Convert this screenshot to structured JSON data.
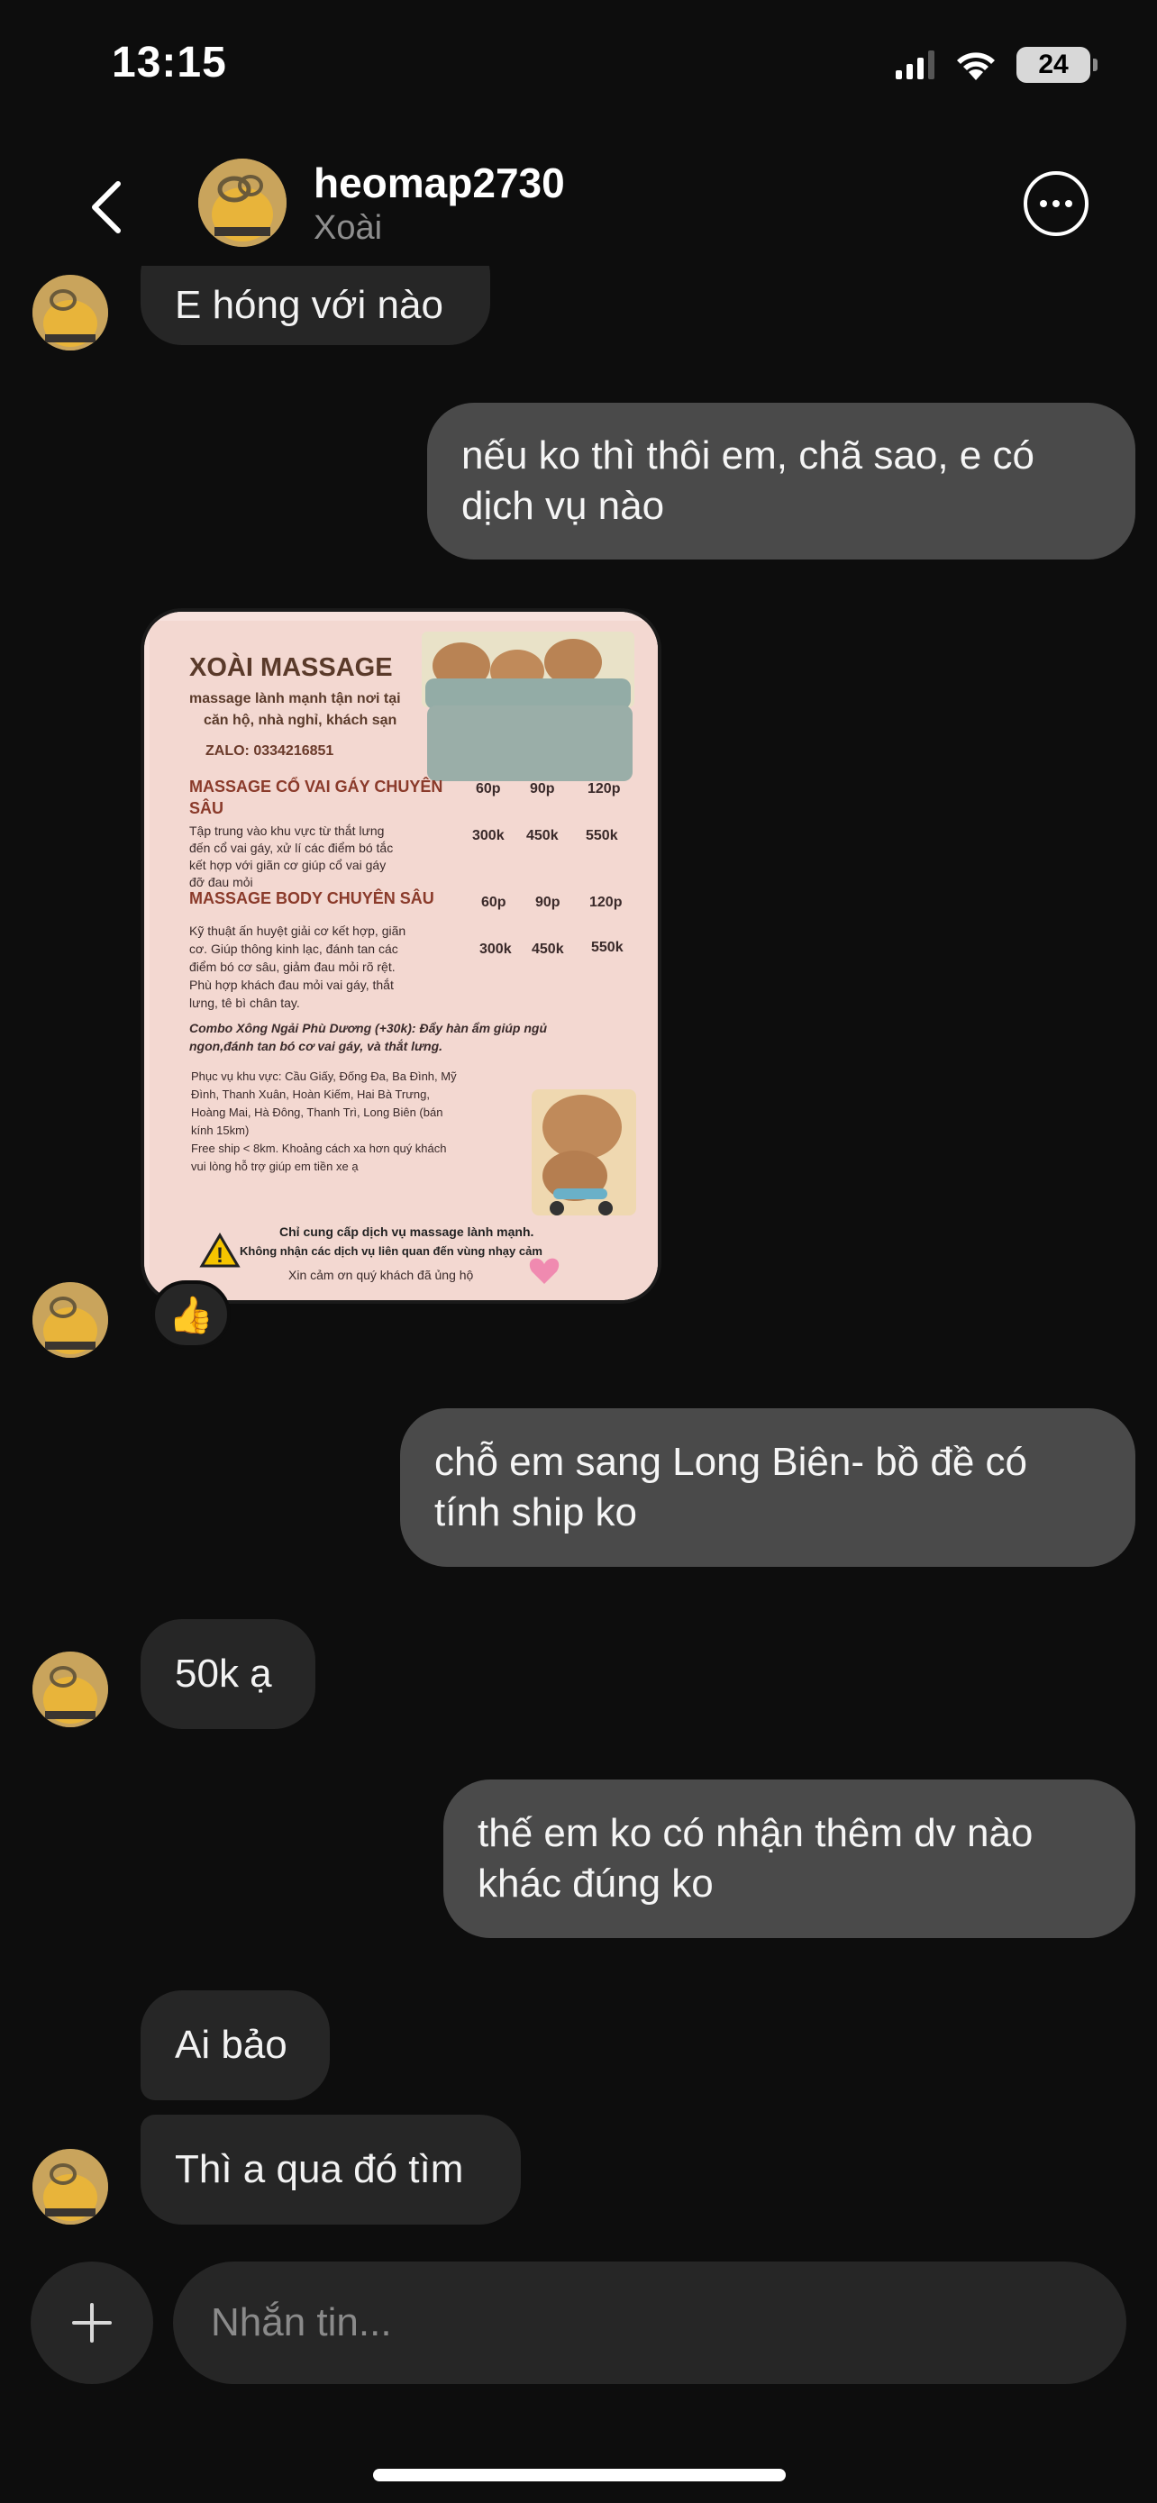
{
  "status_bar": {
    "time": "13:15",
    "battery": "24",
    "icons": [
      "signal-icon",
      "wifi-icon",
      "battery-icon"
    ]
  },
  "header": {
    "name": "heomap2730",
    "subtitle": "Xoài",
    "icons": [
      "back-arrow-icon",
      "more-options-icon"
    ]
  },
  "messages": [
    {
      "id": "m1",
      "direction": "in",
      "text": "E hóng với nào"
    },
    {
      "id": "m2",
      "direction": "out",
      "text": "nếu ko thì thôi em, chã sao, e có dịch vụ nào"
    },
    {
      "id": "m3",
      "direction": "in",
      "type": "image",
      "reaction": "👍"
    },
    {
      "id": "m4",
      "direction": "out",
      "text": "chỗ em sang Long Biên- bồ đề có tính ship ko"
    },
    {
      "id": "m5",
      "direction": "in",
      "text": "50k ạ"
    },
    {
      "id": "m6",
      "direction": "out",
      "text": "thế em ko có nhận thêm dv nào khác đúng ko"
    },
    {
      "id": "m7",
      "direction": "in",
      "text": "Ai bảo"
    },
    {
      "id": "m8",
      "direction": "in",
      "text": "Thì a qua đó tìm"
    }
  ],
  "flyer": {
    "title": "XOÀI MASSAGE",
    "tagline_1": "massage lành mạnh tận nơi tại",
    "tagline_2": "căn hộ, nhà nghỉ, khách sạn",
    "zalo": "ZALO: 0334216851",
    "durations": [
      "60p",
      "90p",
      "120p"
    ],
    "service_1": {
      "name_1": "MASSAGE CỔ VAI GÁY CHUYÊN",
      "name_2": "SÂU",
      "prices": [
        "300k",
        "450k",
        "550k"
      ],
      "desc": [
        "Tập trung vào khu vực từ thắt lưng",
        "đến cổ vai gáy, xử lí các điểm bó tắc",
        "kết hợp với giãn cơ giúp cổ vai gáy",
        "đỡ đau mỏi"
      ]
    },
    "service_2": {
      "name": "MASSAGE BODY CHUYÊN SÂU",
      "prices": [
        "300k",
        "450k",
        "550k"
      ],
      "desc": [
        "Kỹ thuật ấn huyệt giải cơ kết hợp, giãn",
        "cơ. Giúp thông kinh lạc, đánh tan các",
        "điểm bó cơ sâu, giảm đau mỏi rõ rệt.",
        "Phù hợp khách đau mỏi vai gáy, thắt",
        "lưng, tê bì chân tay."
      ]
    },
    "combo": [
      "Combo Xông Ngải Phù Dương (+30k): Đẩy hàn ẩm giúp ngủ",
      "ngon,đánh tan bó cơ vai gáy, và thắt lưng."
    ],
    "area": [
      "Phục vụ khu vực: Cầu Giấy, Đống Đa, Ba Đình, Mỹ",
      "Đình, Thanh Xuân, Hoàn Kiếm, Hai Bà Trưng,",
      "Hoàng Mai, Hà Đông, Thanh Trì, Long Biên (bán",
      "kính 15km)",
      "Free ship < 8km. Khoảng cách xa hơn quý khách",
      "vui lòng hỗ trợ giúp em tiền xe ạ"
    ],
    "notice_1": "Chỉ cung cấp dịch vụ massage lành mạnh.",
    "notice_2": "Không nhận các dịch vụ liên quan đến vùng nhạy cảm",
    "thanks": "Xin cảm ơn quý  khách đã ủng hộ"
  },
  "composer": {
    "placeholder": "Nhắn tin..."
  },
  "colors": {
    "background": "#0d0d0d",
    "incoming_bubble": "#262626",
    "outgoing_bubble": "#4a4a4a",
    "flyer_bg": "#f7e1dc",
    "flyer_title": "#5a3a2a",
    "flyer_heading": "#8a3a2a"
  }
}
